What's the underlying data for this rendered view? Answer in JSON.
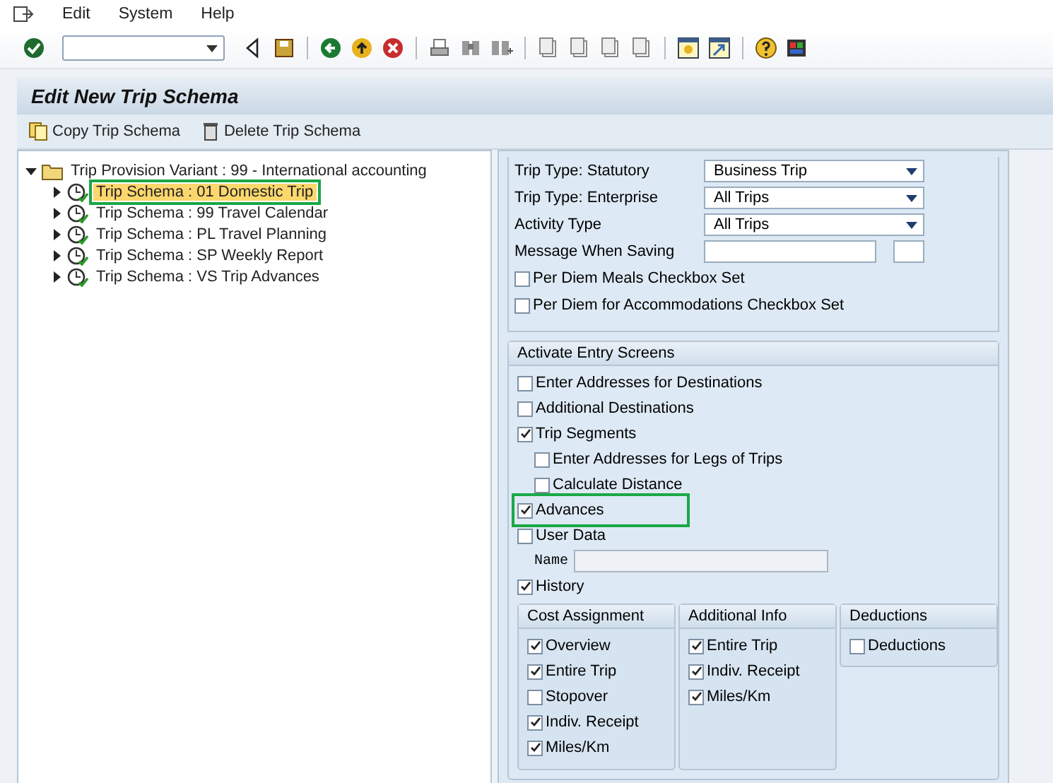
{
  "menu": [
    {
      "label": "Edit"
    },
    {
      "label": "System"
    },
    {
      "label": "Help"
    }
  ],
  "title": "Edit New Trip Schema",
  "actions": [
    {
      "label": "Copy Trip Schema",
      "kind": "copy"
    },
    {
      "label": "Delete Trip Schema",
      "kind": "delete"
    }
  ],
  "tree": {
    "label": "Trip Provision Variant : 99  - International accounting",
    "expanded": true,
    "children": [
      {
        "label": "Trip Schema : 01 Domestic Trip",
        "selected": true,
        "highlighted": true
      },
      {
        "label": "Trip Schema : 99 Travel Calendar",
        "selected": false,
        "highlighted": false
      },
      {
        "label": "Trip Schema : PL Travel Planning",
        "selected": false,
        "highlighted": false
      },
      {
        "label": "Trip Schema : SP Weekly Report",
        "selected": false,
        "highlighted": false
      },
      {
        "label": "Trip Schema : VS Trip Advances",
        "selected": false,
        "highlighted": false
      }
    ]
  },
  "form": {
    "rows": [
      {
        "label": "Trip Type: Statutory",
        "kind": "dropdown",
        "value": "Business Trip"
      },
      {
        "label": "Trip Type: Enterprise",
        "kind": "dropdown",
        "value": "All Trips"
      },
      {
        "label": "Activity Type",
        "kind": "dropdown",
        "value": "All Trips"
      },
      {
        "label": "Message When Saving",
        "kind": "text"
      }
    ],
    "checkboxes": [
      {
        "label": "Per Diem Meals Checkbox Set",
        "checked": false
      },
      {
        "label": "Per Diem for Accommodations Checkbox Set",
        "checked": false
      }
    ]
  },
  "entry_screens": {
    "title": "Activate Entry Screens",
    "items": [
      {
        "label": "Enter Addresses for Destinations",
        "checked": false,
        "highlighted": false
      },
      {
        "label": "Additional Destinations",
        "checked": false,
        "highlighted": false
      },
      {
        "label": "Trip Segments",
        "checked": true,
        "highlighted": false,
        "children": [
          {
            "label": "Enter Addresses for Legs of Trips",
            "checked": false,
            "highlighted": false
          },
          {
            "label": "Calculate Distance",
            "checked": false,
            "highlighted": false
          }
        ]
      },
      {
        "label": "Advances",
        "checked": true,
        "highlighted": true
      },
      {
        "label": "User Data",
        "checked": false,
        "highlighted": false,
        "field": {
          "label": "Name"
        }
      },
      {
        "label": "History",
        "checked": true,
        "highlighted": false
      }
    ],
    "groups": [
      {
        "title": "Cost Assignment",
        "items": [
          {
            "label": "Overview",
            "checked": true
          },
          {
            "label": "Entire Trip",
            "checked": true
          },
          {
            "label": "Stopover",
            "checked": false
          },
          {
            "label": "Indiv. Receipt",
            "checked": true
          },
          {
            "label": "Miles/Km",
            "checked": true
          }
        ]
      },
      {
        "title": "Additional Info",
        "items": [
          {
            "label": "Entire Trip",
            "checked": true
          },
          {
            "label": "Indiv. Receipt",
            "checked": true
          },
          {
            "label": "Miles/Km",
            "checked": true
          }
        ]
      },
      {
        "title": "Deductions",
        "items": [
          {
            "label": "Deductions",
            "checked": false
          }
        ]
      }
    ]
  }
}
